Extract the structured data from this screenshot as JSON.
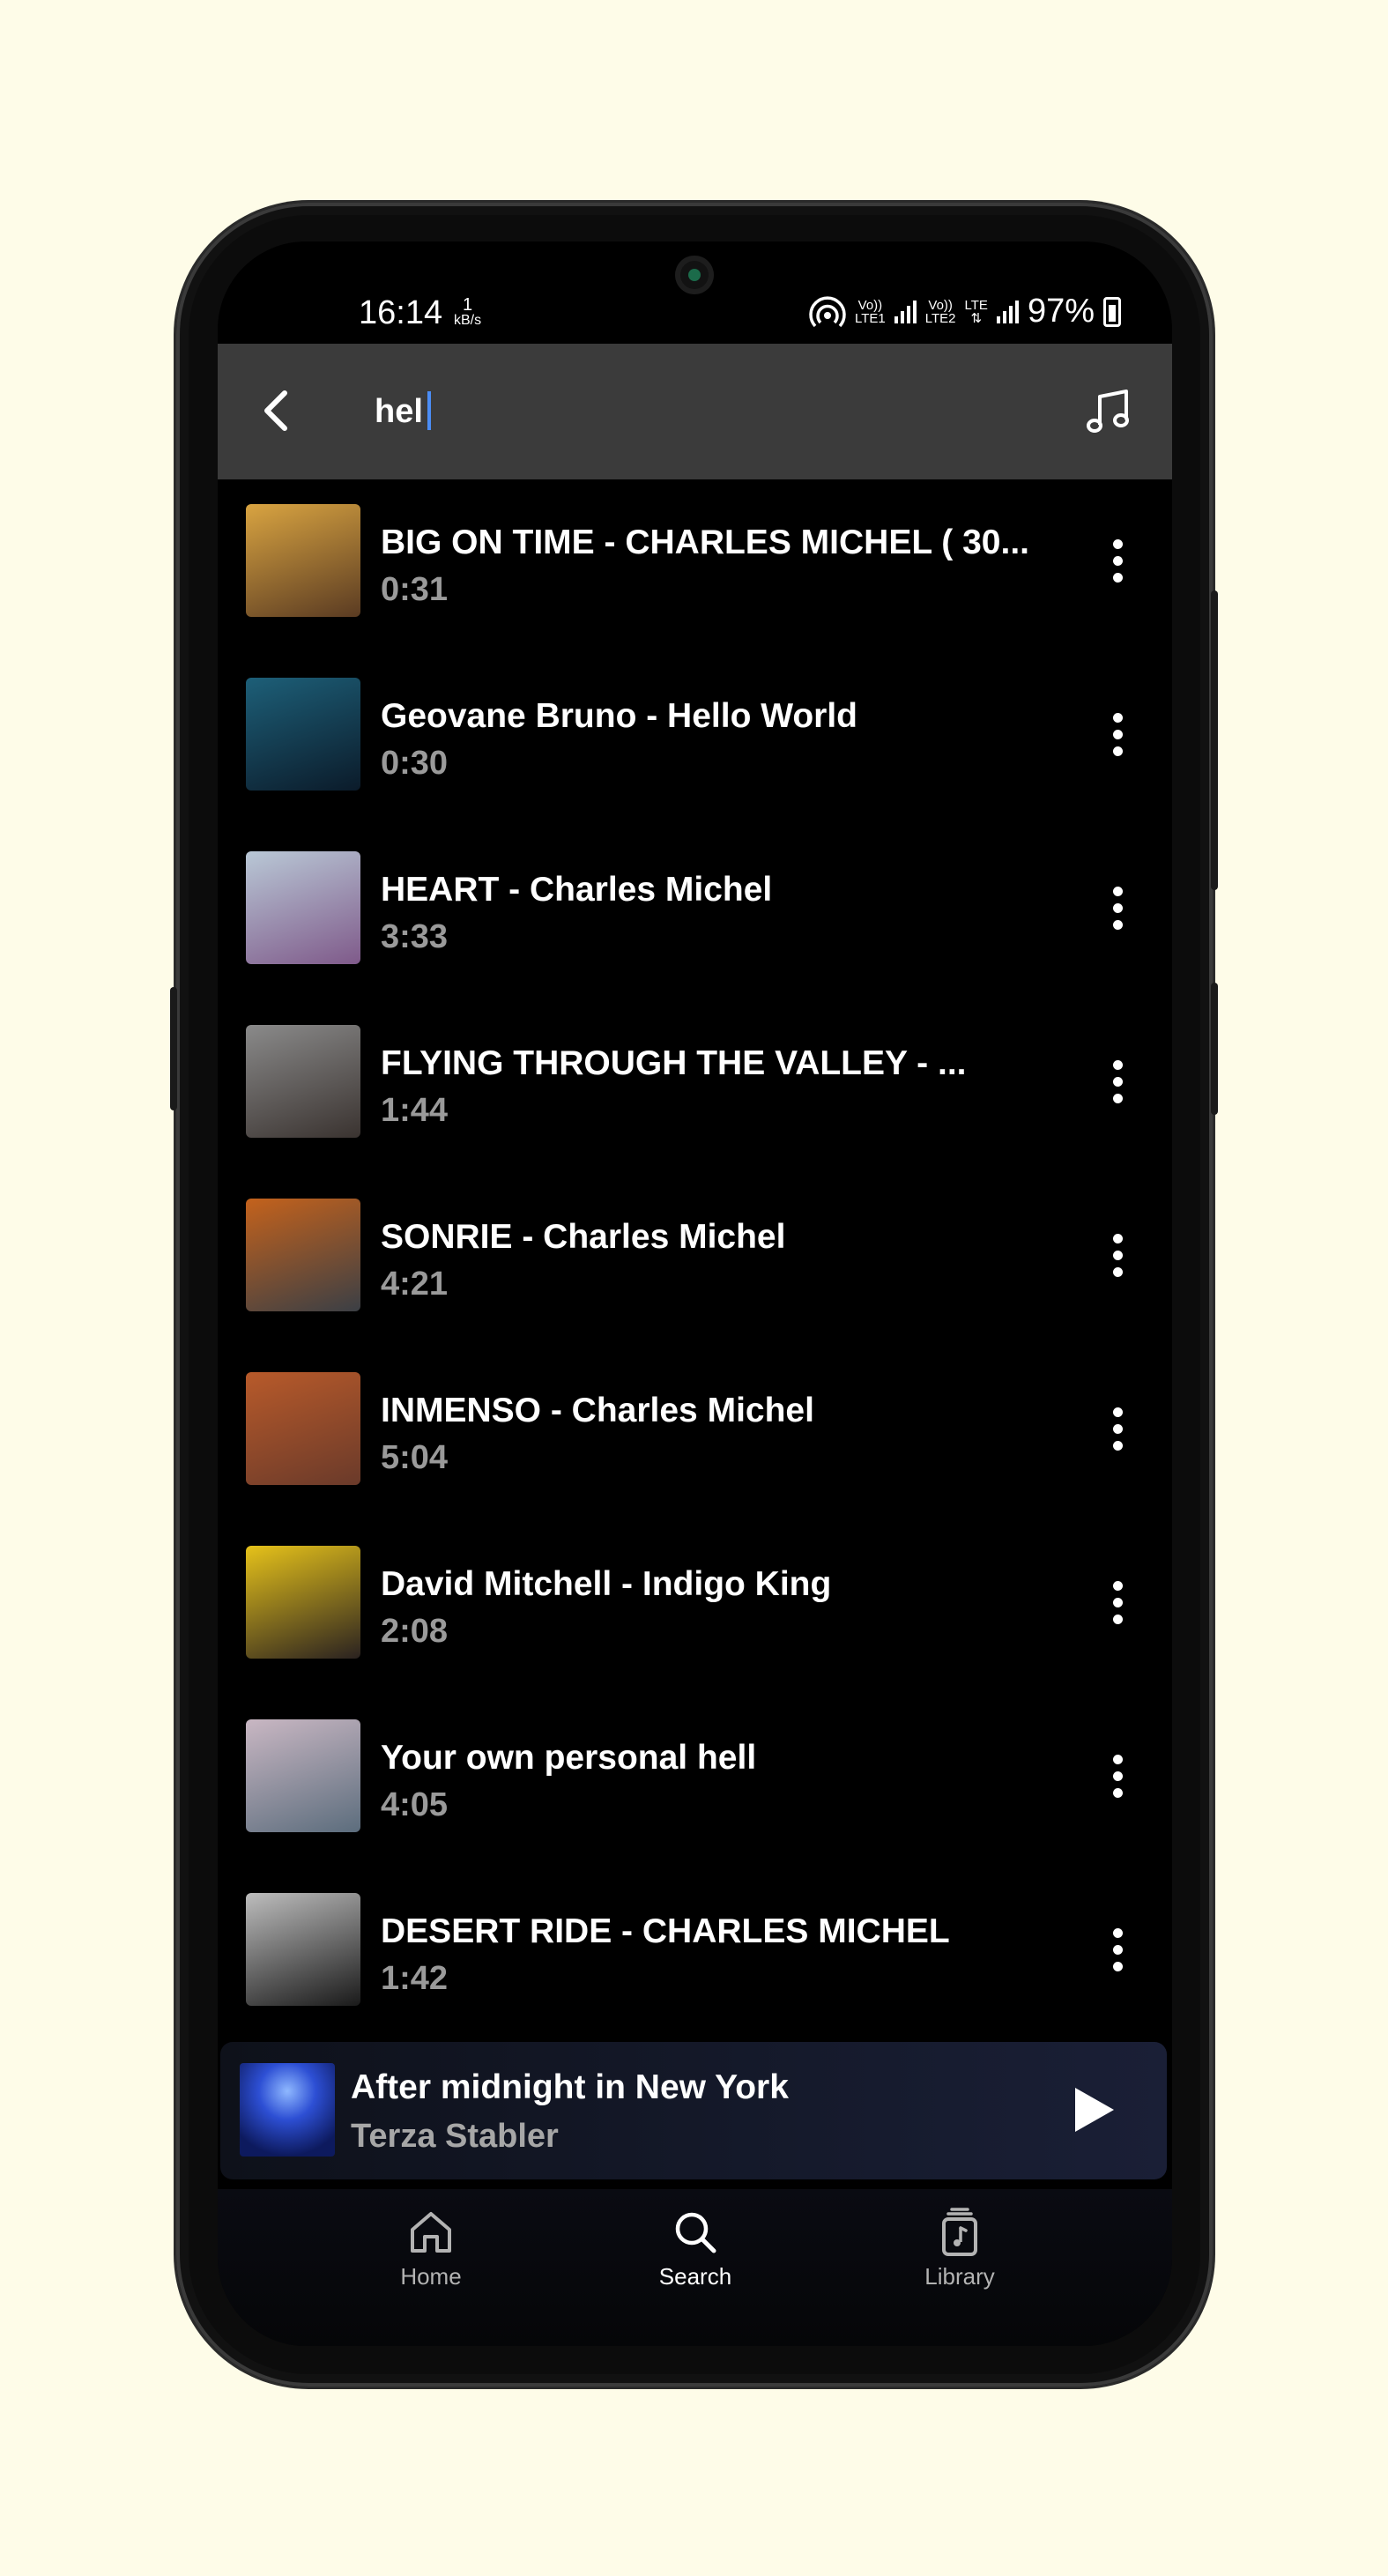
{
  "status_bar": {
    "time": "16:14",
    "net_speed_value": "1",
    "net_speed_unit": "kB/s",
    "sim1_label_top": "Vo))",
    "sim1_label_bottom": "LTE1",
    "sim2_label_top": "Vo))",
    "sim2_label_bottom": "LTE2",
    "lte_label": "LTE",
    "battery_percent": "97%"
  },
  "search": {
    "query": "hel"
  },
  "results": [
    {
      "title": "BIG ON TIME - CHARLES MICHEL ( 30...",
      "duration": "0:31",
      "thumb_colors": [
        "#d9a441",
        "#5a3b22"
      ]
    },
    {
      "title": "Geovane Bruno - Hello World",
      "duration": "0:30",
      "thumb_colors": [
        "#1d5f78",
        "#0b1b2a"
      ]
    },
    {
      "title": "HEART - Charles Michel",
      "duration": "3:33",
      "thumb_colors": [
        "#b9c8d6",
        "#7f5a8a"
      ]
    },
    {
      "title": "FLYING THROUGH THE VALLEY - ...",
      "duration": "1:44",
      "thumb_colors": [
        "#8a8a8a",
        "#3a3330"
      ]
    },
    {
      "title": "SONRIE  - Charles Michel",
      "duration": "4:21",
      "thumb_colors": [
        "#c4621c",
        "#3b3f45"
      ]
    },
    {
      "title": "INMENSO - Charles Michel",
      "duration": "5:04",
      "thumb_colors": [
        "#b85a2a",
        "#6a3a2a"
      ]
    },
    {
      "title": "David Mitchell - Indigo King",
      "duration": "2:08",
      "thumb_colors": [
        "#e6c21a",
        "#2a2220"
      ]
    },
    {
      "title": "Your own personal hell",
      "duration": "4:05",
      "thumb_colors": [
        "#c9b7c3",
        "#5c6d7d"
      ]
    },
    {
      "title": "DESERT RIDE - CHARLES MICHEL",
      "duration": "1:42",
      "thumb_colors": [
        "#bdbdbd",
        "#1a1a1a"
      ]
    }
  ],
  "now_playing": {
    "title": "After midnight in New York",
    "artist": "Terza Stabler"
  },
  "nav": {
    "home": "Home",
    "search": "Search",
    "library": "Library",
    "active_color": "#ffffff",
    "inactive_color": "#b3b3b3"
  }
}
